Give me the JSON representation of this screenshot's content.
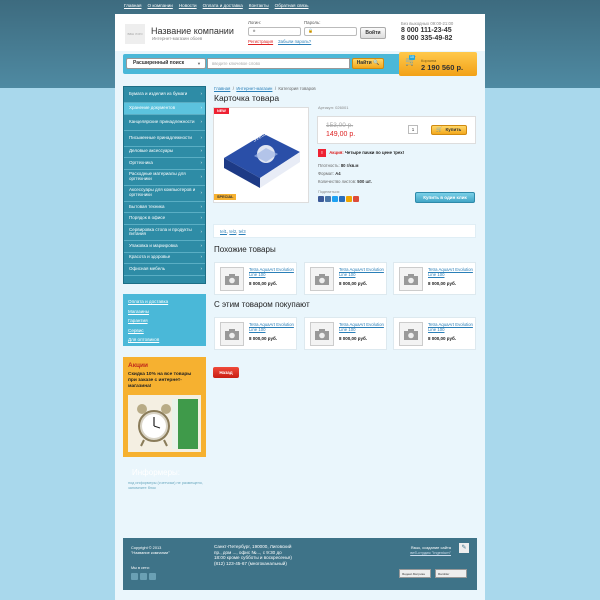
{
  "top_nav": [
    "Главная",
    "О компании",
    "Новости",
    "Оплата и доставка",
    "Контакты",
    "Обратная связь"
  ],
  "header": {
    "logo_text": "ваш лого",
    "company_name": "Название компании",
    "company_sub": "Интернет-магазин обоев",
    "login_label": "Логин:",
    "password_label": "Пароль:",
    "login_button": "Войти",
    "register_link": "Регистрация",
    "forgot_link": "Забыли пароль?",
    "hours": "Без выходных 09:00-21:00",
    "phone1": "8 000 111-23-45",
    "phone2": "8 000 335-49-82"
  },
  "search": {
    "type": "Расширенный поиск",
    "placeholder": "введите ключевое слово",
    "button": "Найти"
  },
  "cart": {
    "count": "10",
    "label": "Корзина",
    "sum": "2 190 560 р."
  },
  "categories": [
    "Бумага и изделия из бумаги",
    "Хранение документов",
    "Канцелярские принадлежности",
    "Письменные принадлежности",
    "Деловые аксессуары",
    "Оргтехника",
    "Расходные материалы для оргтехники",
    "Аксессуары для компьютеров и оргтехники",
    "Бытовая техника",
    "Порядок в офисе",
    "Сервировка стола и продукты питания",
    "Упаковка и маркировка",
    "Красота и здоровье",
    "Офисная мебель"
  ],
  "side_links": [
    "Оплата и доставка",
    "Магазины",
    "Гарантия",
    "Сервис",
    "Для оптовиков"
  ],
  "promo": {
    "title": "Акции",
    "text": "Скидка 10% на все товары при заказе с интернет-магазина!"
  },
  "informers": {
    "title": "Информеры:",
    "text": "под информеры (счетчики) не размещено, запомните блок"
  },
  "breadcrumb": [
    "Главная",
    "Интернет-магазин",
    "Категория товаров"
  ],
  "page_title": "Карточка товара",
  "product": {
    "badge_new": "NEW",
    "badge_special": "SPECIAL",
    "article": "Артикул: 026001",
    "old_price": "153,00 р.",
    "new_price": "149,00 р.",
    "qty": "1",
    "add_to_cart": "Купить",
    "promo_label": "Акция:",
    "promo_text": "Четыре пачки по цене трех!",
    "specs": [
      {
        "k": "Плотность:",
        "v": "80 г/кв.м"
      },
      {
        "k": "Формат:",
        "v": "А4"
      },
      {
        "k": "Количество листов:",
        "v": "500 шт."
      }
    ],
    "share_label": "Поделиться:",
    "one_click": "Купить в один клик"
  },
  "tags": [
    "tel1",
    "tel2",
    "tel3"
  ],
  "similar_title": "Похожие товары",
  "bought_title": "С этим товаром покупают",
  "cards": [
    {
      "name": "Tetra AquaArt Evolution Line 100",
      "price": "8 000,00 руб."
    },
    {
      "name": "Tetra AquaArt Evolution Line 100",
      "price": "8 000,00 руб."
    },
    {
      "name": "Tetra AquaArt Evolution Line 100",
      "price": "8 000,00 руб."
    }
  ],
  "back_button": "Назад",
  "footer": {
    "copyright1": "Copyright © 2013",
    "copyright2": "\"Название компании\"",
    "social_label": "Мы в сети:",
    "address": "Санкт-Петербург, 190000, Лиговский пр., дом ..., офис №..., с 9:30 до 18:00 кроме субботы и воскресенья) (812) 123-45-67 (многоканальный)",
    "dev_line1": "Язык, создание сайта",
    "dev_line2": "веб-студия \"Ingenium\"",
    "counter1": "Яндекс.Метрика",
    "counter2": "Rambler"
  },
  "colors": {
    "accent_blue": "#4ab8d8",
    "accent_orange": "#f6b130",
    "price_red": "#d22222"
  }
}
